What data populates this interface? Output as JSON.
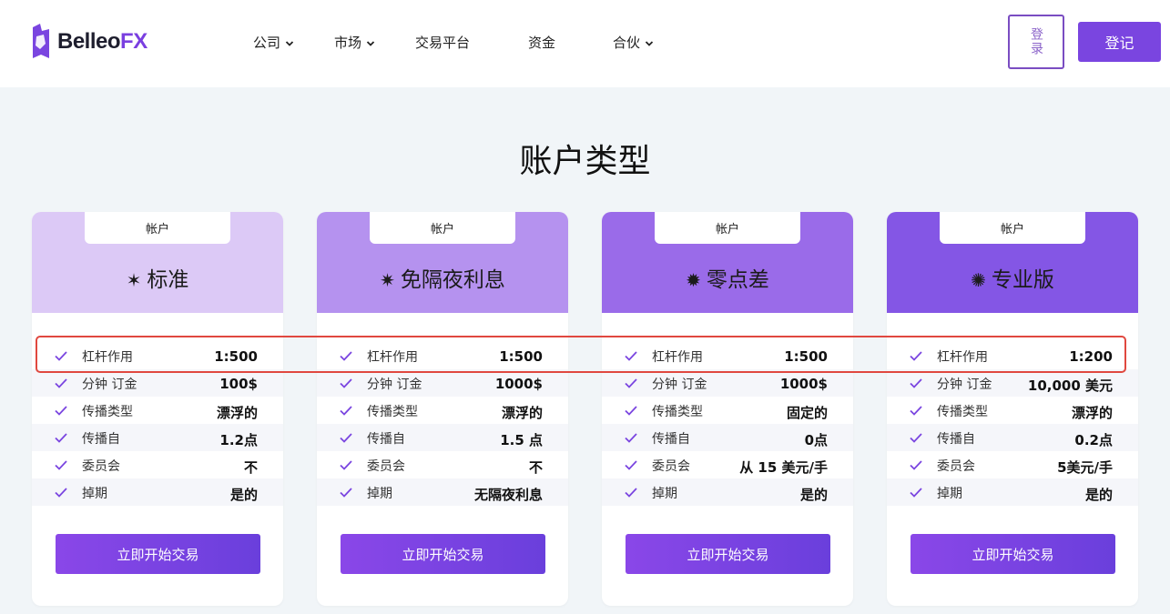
{
  "header": {
    "logo": {
      "text_main": "Belleo",
      "text_accent": "FX"
    },
    "nav": [
      {
        "label": "公司",
        "has_dropdown": true
      },
      {
        "label": "市场",
        "has_dropdown": true
      },
      {
        "label": "交易平台",
        "has_dropdown": false
      },
      {
        "label": "资金",
        "has_dropdown": false
      },
      {
        "label": "合伙",
        "has_dropdown": true
      }
    ],
    "login_label": "登录",
    "register_label": "登记"
  },
  "section_title": "账户类型",
  "cards": [
    {
      "tab_label": "帐户",
      "star": "✶",
      "name": "标准",
      "head_color": "#dcc9f6",
      "rows": [
        {
          "label": "杠杆作用",
          "value": "1:500"
        },
        {
          "label": "分钟 订金",
          "value": "100$"
        },
        {
          "label": "传播类型",
          "value": "漂浮的"
        },
        {
          "label": "传播自",
          "value": "1.2点"
        },
        {
          "label": "委员会",
          "value": "不"
        },
        {
          "label": "掉期",
          "value": "是的"
        }
      ],
      "cta_label": "立即开始交易"
    },
    {
      "tab_label": "帐户",
      "star": "✷",
      "name": "免隔夜利息",
      "head_color": "#b592ef",
      "rows": [
        {
          "label": "杠杆作用",
          "value": "1:500"
        },
        {
          "label": "分钟 订金",
          "value": "1000$"
        },
        {
          "label": "传播类型",
          "value": "漂浮的"
        },
        {
          "label": "传播自",
          "value": "1.5 点"
        },
        {
          "label": "委员会",
          "value": "不"
        },
        {
          "label": "掉期",
          "value": "无隔夜利息"
        }
      ],
      "cta_label": "立即开始交易"
    },
    {
      "tab_label": "帐户",
      "star": "✹",
      "name": "零点差",
      "head_color": "#9a6be9",
      "rows": [
        {
          "label": "杠杆作用",
          "value": "1:500"
        },
        {
          "label": "分钟 订金",
          "value": "1000$"
        },
        {
          "label": "传播类型",
          "value": "固定的"
        },
        {
          "label": "传播自",
          "value": "0点"
        },
        {
          "label": "委员会",
          "value": "从 15 美元/手"
        },
        {
          "label": "掉期",
          "value": "是的"
        }
      ],
      "cta_label": "立即开始交易"
    },
    {
      "tab_label": "帐户",
      "star": "✺",
      "name": "专业版",
      "head_color": "#8456e5",
      "rows": [
        {
          "label": "杠杆作用",
          "value": "1:200"
        },
        {
          "label": "分钟 订金",
          "value": "10,000 美元"
        },
        {
          "label": "传播类型",
          "value": "漂浮的"
        },
        {
          "label": "传播自",
          "value": "0.2点"
        },
        {
          "label": "委员会",
          "value": "5美元/手"
        },
        {
          "label": "掉期",
          "value": "是的"
        }
      ],
      "cta_label": "立即开始交易"
    }
  ],
  "colors": {
    "accent": "#7a45e0",
    "check": "#7a45e0",
    "highlight_border": "#e0483f"
  }
}
